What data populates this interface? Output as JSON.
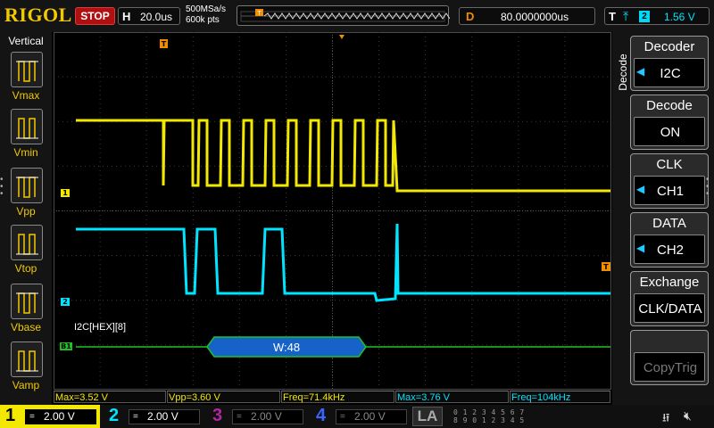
{
  "top_bar": {
    "brand": "RIGOL",
    "run_state": "STOP",
    "timebase_key": "H",
    "timebase_value": "20.0us",
    "sample_rate": "500MSa/s",
    "memory_depth": "600k pts",
    "trigger_marker": "T",
    "delay_key": "D",
    "delay_value": "80.0000000us",
    "trigger_key": "T",
    "trigger_edge_icon": "rising-edge-icon",
    "trigger_source": "2",
    "trigger_level": "1.56 V"
  },
  "left_panel": {
    "title": "Vertical",
    "items": [
      {
        "label": "Vmax",
        "icon": "vmax-icon"
      },
      {
        "label": "Vmin",
        "icon": "vmin-icon"
      },
      {
        "label": "Vpp",
        "icon": "vpp-icon"
      },
      {
        "label": "Vtop",
        "icon": "vtop-icon"
      },
      {
        "label": "Vbase",
        "icon": "vbase-icon"
      },
      {
        "label": "Vamp",
        "icon": "vamp-icon"
      }
    ]
  },
  "right_menu": {
    "tab_label": "Decode",
    "items": [
      {
        "title": "Decoder",
        "value": "I2C",
        "has_arrow": true
      },
      {
        "title": "Decode",
        "value": "ON",
        "has_arrow": false
      },
      {
        "title": "CLK",
        "value": "CH1",
        "has_arrow": true
      },
      {
        "title": "DATA",
        "value": "CH2",
        "has_arrow": true
      },
      {
        "title": "Exchange",
        "value": "CLK/DATA",
        "has_arrow": false
      },
      {
        "title": "",
        "value": "CopyTrig",
        "has_arrow": false,
        "disabled": true
      }
    ]
  },
  "waveform": {
    "ch1_marker": "1",
    "ch2_marker": "2",
    "bus_marker": "B1",
    "trigger_level_marker": "T",
    "trigger_position_marker": "T",
    "decode_label": "I2C[HEX][8]",
    "decode_packet": "W:48",
    "colors": {
      "ch1": "#f2e800",
      "ch2": "#00e4ff",
      "bus": "#22c122",
      "packet_fill": "#1762c8",
      "trigger": "#f28c00"
    }
  },
  "measurements": [
    {
      "text": "Max=3.52 V",
      "channel": "ch1"
    },
    {
      "text": "Vpp=3.60 V",
      "channel": "ch1"
    },
    {
      "text": "Freq=71.4kHz",
      "channel": "ch1"
    },
    {
      "text": "Max=3.76 V",
      "channel": "ch2"
    },
    {
      "text": "Freq=104kHz",
      "channel": "ch2"
    }
  ],
  "channels": [
    {
      "number": "1",
      "coupling": "=",
      "scale": "2.00 V",
      "color": "#f2e800",
      "active": true
    },
    {
      "number": "2",
      "coupling": "=",
      "scale": "2.00 V",
      "color": "#00e4ff",
      "active": false
    },
    {
      "number": "3",
      "coupling": "=",
      "scale": "2.00 V",
      "color": "#b0299a",
      "active": false
    },
    {
      "number": "4",
      "coupling": "=",
      "scale": "2.00 V",
      "color": "#3a66ff",
      "active": false
    }
  ],
  "logic_analyzer": {
    "label": "LA",
    "digits_row1": "0 1 2 3  4 5 6 7",
    "digits_row2": "8 9 0 1  2 3 4 5"
  },
  "status_icons": [
    "usb-icon",
    "speaker-mute-icon"
  ]
}
